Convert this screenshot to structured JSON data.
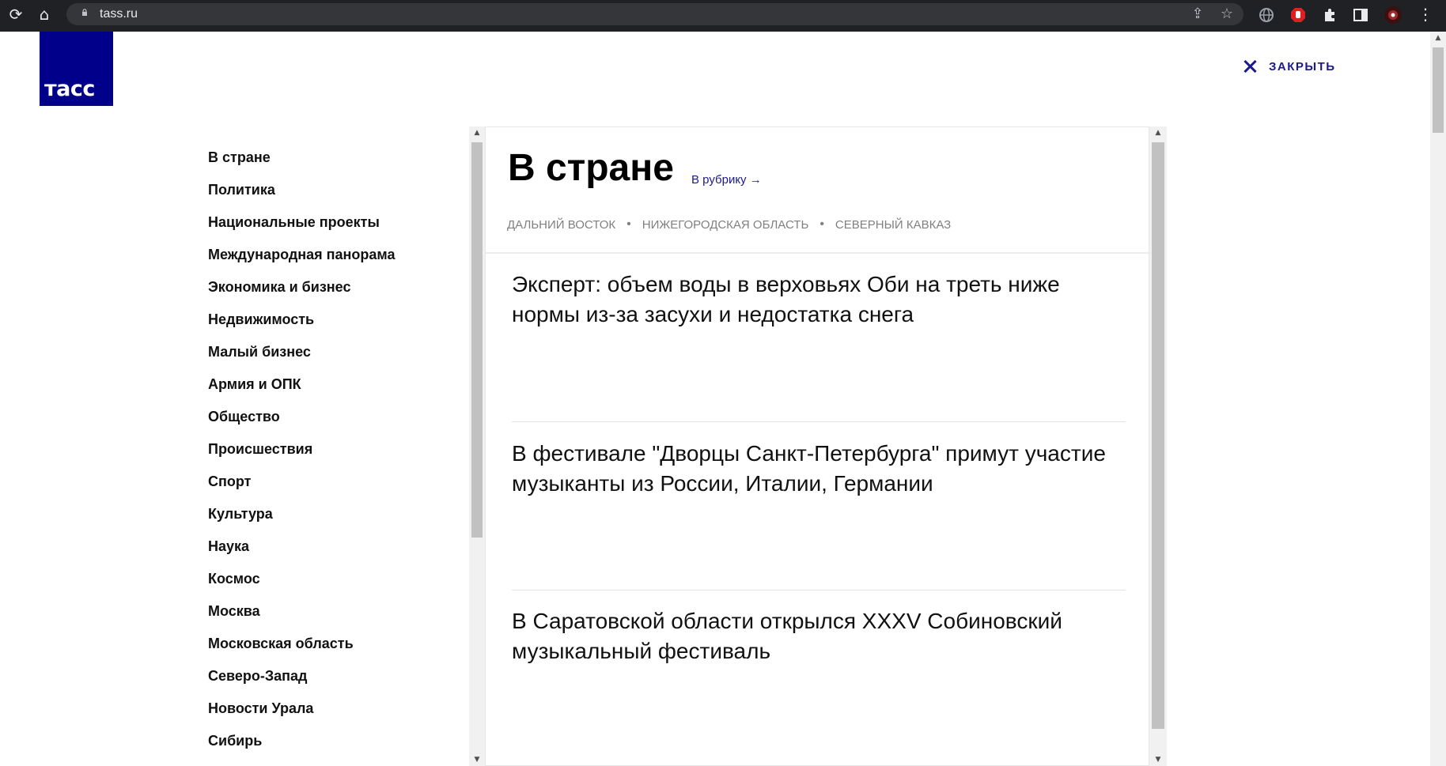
{
  "browser": {
    "url": "tass.ru",
    "reload_glyph": "⟳",
    "home_glyph": "⌂",
    "share_glyph": "⇪",
    "star_glyph": "☆",
    "menu_glyph": "⋮",
    "extensions": [
      "globe-icon",
      "adblock-icon",
      "puzzle-icon",
      "sidepanel-icon",
      "profile-avatar"
    ]
  },
  "logo": {
    "text": "тасс"
  },
  "close": {
    "label": "ЗАКРЫТЬ"
  },
  "categories": [
    "В стране",
    "Политика",
    "Национальные проекты",
    "Международная панорама",
    "Экономика и бизнес",
    "Недвижимость",
    "Малый бизнес",
    "Армия и ОПК",
    "Общество",
    "Происшествия",
    "Спорт",
    "Культура",
    "Наука",
    "Космос",
    "Москва",
    "Московская область",
    "Северо-Запад",
    "Новости Урала",
    "Сибирь"
  ],
  "panel": {
    "title": "В стране",
    "to_rubric": "В рубрику →",
    "tags": [
      "ДАЛЬНИЙ ВОСТОК",
      "НИЖЕГОРОДСКАЯ ОБЛАСТЬ",
      "СЕВЕРНЫЙ КАВКАЗ"
    ],
    "tag_separator": "•",
    "news": [
      "Эксперт: объем воды в верховьях Оби на треть ниже нормы из-за засухи и недостатка снега",
      "В фестивале \"Дворцы Санкт-Петербурга\" примут участие музыканты из России, Италии, Германии",
      "В Саратовской области открылся XXXV Собиновский музыкальный фестиваль"
    ]
  },
  "colors": {
    "brand": "#00008b",
    "link": "#1a1a8a",
    "tag_text": "#808080"
  }
}
